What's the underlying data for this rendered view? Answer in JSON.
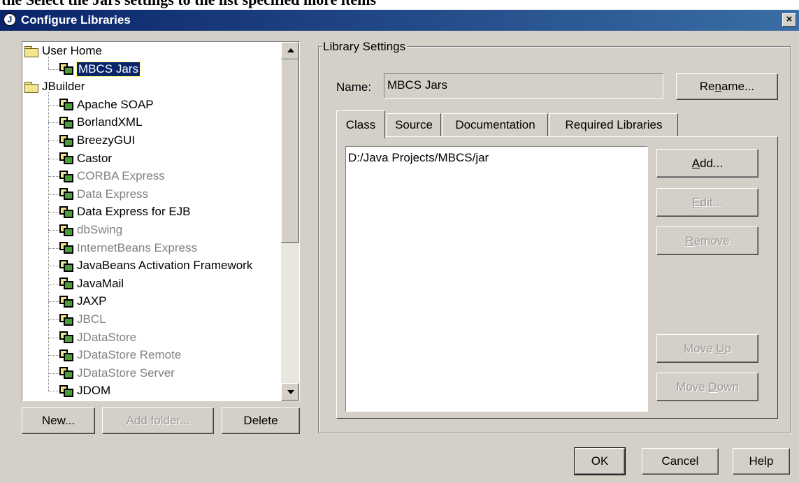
{
  "caption": "the Select the Jars settings to the list specified more items",
  "window": {
    "title": "Configure Libraries",
    "app_icon": "jbuilder-icon",
    "close_glyph": "×"
  },
  "tree": {
    "nodes": [
      {
        "label": "User Home",
        "type": "folder",
        "level": 0,
        "enabled": true
      },
      {
        "label": "MBCS Jars",
        "type": "library",
        "level": 1,
        "enabled": true,
        "selected": true
      },
      {
        "label": "JBuilder",
        "type": "folder",
        "level": 0,
        "enabled": true
      },
      {
        "label": "Apache SOAP",
        "type": "library",
        "level": 1,
        "enabled": true
      },
      {
        "label": "BorlandXML",
        "type": "library",
        "level": 1,
        "enabled": true
      },
      {
        "label": "BreezyGUI",
        "type": "library",
        "level": 1,
        "enabled": true
      },
      {
        "label": "Castor",
        "type": "library",
        "level": 1,
        "enabled": true
      },
      {
        "label": "CORBA Express",
        "type": "library",
        "level": 1,
        "enabled": false
      },
      {
        "label": "Data Express",
        "type": "library",
        "level": 1,
        "enabled": false
      },
      {
        "label": "Data Express for EJB",
        "type": "library",
        "level": 1,
        "enabled": true
      },
      {
        "label": "dbSwing",
        "type": "library",
        "level": 1,
        "enabled": false
      },
      {
        "label": "InternetBeans Express",
        "type": "library",
        "level": 1,
        "enabled": false
      },
      {
        "label": "JavaBeans Activation Framework",
        "type": "library",
        "level": 1,
        "enabled": true
      },
      {
        "label": "JavaMail",
        "type": "library",
        "level": 1,
        "enabled": true
      },
      {
        "label": "JAXP",
        "type": "library",
        "level": 1,
        "enabled": true
      },
      {
        "label": "JBCL",
        "type": "library",
        "level": 1,
        "enabled": false
      },
      {
        "label": "JDataStore",
        "type": "library",
        "level": 1,
        "enabled": false
      },
      {
        "label": "JDataStore Remote",
        "type": "library",
        "level": 1,
        "enabled": false
      },
      {
        "label": "JDataStore Server",
        "type": "library",
        "level": 1,
        "enabled": false
      },
      {
        "label": "JDOM",
        "type": "library",
        "level": 1,
        "enabled": true
      }
    ]
  },
  "left_buttons": {
    "new": "New...",
    "add_folder": "Add folder...",
    "delete": "Delete"
  },
  "settings": {
    "group_title": "Library Settings",
    "name_label": "Name:",
    "name_value": "MBCS Jars",
    "rename_pre": "Re",
    "rename_key": "n",
    "rename_post": "ame..."
  },
  "tabs": [
    {
      "label": "Class",
      "active": true
    },
    {
      "label": "Source",
      "active": false
    },
    {
      "label": "Documentation",
      "active": false
    },
    {
      "label": "Required Libraries",
      "active": false
    }
  ],
  "class_paths": [
    "D:/Java Projects/MBCS/jar"
  ],
  "side_buttons": {
    "add": {
      "key": "A",
      "rest": "dd..."
    },
    "edit": {
      "key": "E",
      "rest": "dit..."
    },
    "remove": {
      "key": "R",
      "rest": "emove"
    },
    "move_up": {
      "pre": "Move ",
      "key": "U",
      "rest": "p"
    },
    "move_down": {
      "pre": "Move ",
      "key": "D",
      "rest": "own"
    }
  },
  "dialog_buttons": {
    "ok": "OK",
    "cancel": "Cancel",
    "help": "Help"
  },
  "colors": {
    "titlebar": "#0a246a",
    "face": "#d4d0c8",
    "selection": "#0a246a",
    "disabled_text": "#808080"
  }
}
